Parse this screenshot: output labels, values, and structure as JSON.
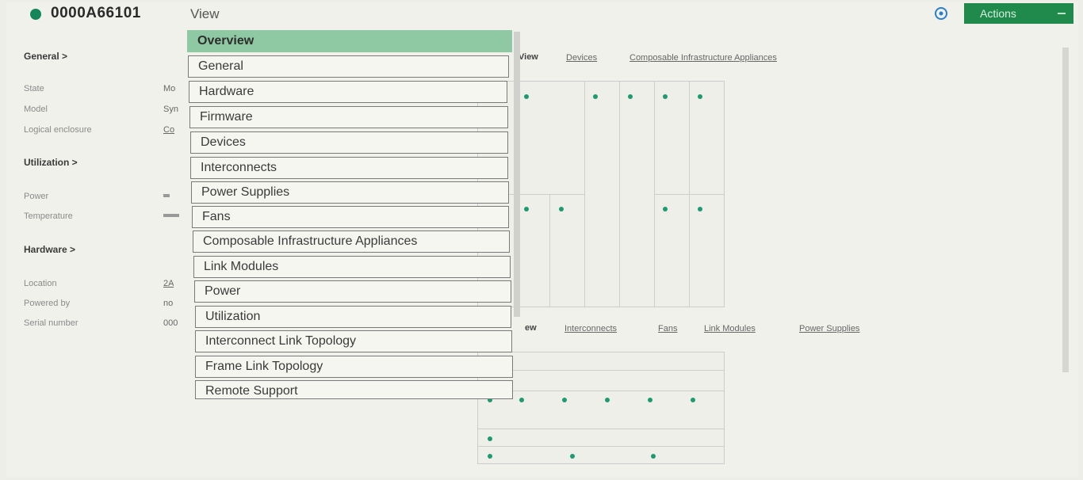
{
  "header": {
    "enclosure_name": "0000A66101",
    "view_label": "View",
    "actions_label": "Actions",
    "help_icon": "help-icon"
  },
  "left_panel": {
    "general_title": "General >",
    "general_fields": [
      {
        "label": "State",
        "value": "Mo"
      },
      {
        "label": "Model",
        "value": "Syn"
      },
      {
        "label": "Logical enclosure",
        "value": "Co"
      }
    ],
    "utilization_title": "Utilization >",
    "utilization_fields": [
      {
        "label": "Power"
      },
      {
        "label": "Temperature"
      }
    ],
    "utilization_levels": {
      "power": 0.1,
      "temperature": 0.25
    },
    "hardware_title": "Hardware >",
    "hardware_fields": [
      {
        "label": "Location",
        "value": "2A"
      },
      {
        "label": "Powered by",
        "value": "no"
      },
      {
        "label": "Serial number",
        "value": "000"
      }
    ]
  },
  "diagram": {
    "front_tabs": [
      "View",
      "Devices",
      "Composable Infrastructure Appliances"
    ],
    "rear_tabs": [
      "ew",
      "Interconnects",
      "Fans",
      "Link Modules",
      "Power Supplies"
    ],
    "led_color": "#1c9a72"
  },
  "view_menu": {
    "items": [
      "Overview",
      "General",
      "Hardware",
      "Firmware",
      "Devices",
      "Interconnects",
      "Power Supplies",
      "Fans",
      "Composable Infrastructure Appliances",
      "Link Modules",
      "Power",
      "Utilization",
      "Interconnect Link Topology",
      "Frame Link Topology",
      "Remote Support"
    ],
    "selected": "Overview",
    "selected_color": "#8ec9a4"
  }
}
